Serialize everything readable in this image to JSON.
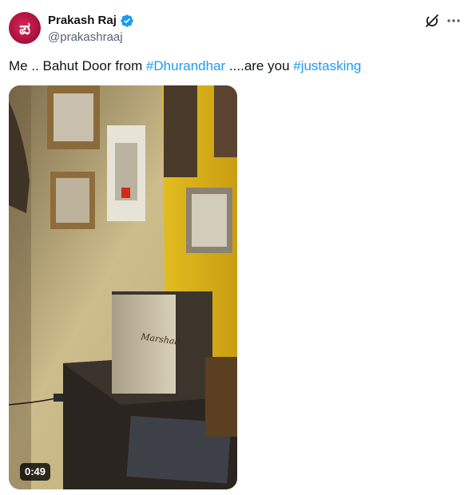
{
  "author": {
    "display_name": "Prakash Raj",
    "handle": "@prakashraaj",
    "verified": true,
    "avatar_glyph": "ಪ",
    "avatar_color": "#c41a4b"
  },
  "tweet": {
    "text_before": "Me .. Bahut Door from ",
    "hashtag1": "#Dhurandhar",
    "text_middle": " ....are you ",
    "hashtag2": "#justasking"
  },
  "media": {
    "type": "video",
    "duration": "0:49",
    "speaker_brand": "Marshall"
  },
  "icons": {
    "verified": "verified-badge-icon",
    "grok": "grok-icon",
    "more": "more-options-icon"
  },
  "colors": {
    "link": "#1d9bf0",
    "verified": "#1d9bf0",
    "secondary_text": "#536471"
  }
}
